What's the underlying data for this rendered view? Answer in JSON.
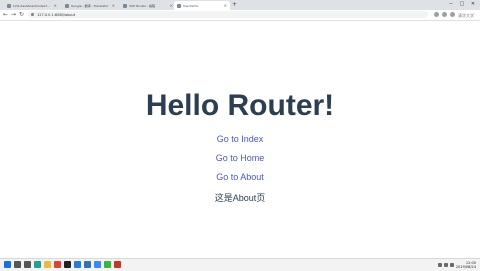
{
  "browser": {
    "tabs": [
      {
        "label": "kimi-dashboard/index?…",
        "active": false
      },
      {
        "label": "Google - 翻译 - Translator",
        "active": false
      },
      {
        "label": "VUE Router - 编程",
        "active": false
      },
      {
        "label": "Vue Demo",
        "active": true
      }
    ],
    "new_tab_symbol": "+",
    "window_controls": {
      "minimize": "−",
      "maximize": "□",
      "close": "✕"
    },
    "nav": {
      "back": "←",
      "forward": "→",
      "reload": "↻"
    },
    "address": "127.0.0.1:8080/about"
  },
  "watermark": "清华大学",
  "page": {
    "title": "Hello Router!",
    "links": [
      {
        "label": "Go to Index"
      },
      {
        "label": "Go to Home"
      },
      {
        "label": "Go to About"
      }
    ],
    "router_view_text": "这是About页"
  },
  "taskbar": {
    "icons": [
      {
        "name": "windows-start-icon",
        "color": "#1e6fd9"
      },
      {
        "name": "search-icon",
        "color": "#555555"
      },
      {
        "name": "task-view-icon",
        "color": "#555555"
      },
      {
        "name": "edge-icon",
        "color": "#2a9d8f"
      },
      {
        "name": "file-explorer-icon",
        "color": "#e9b949"
      },
      {
        "name": "chrome-icon",
        "color": "#db4437"
      },
      {
        "name": "terminal-icon",
        "color": "#222222"
      },
      {
        "name": "vscode-icon",
        "color": "#2b7bd6"
      },
      {
        "name": "store-icon",
        "color": "#3a6fb0"
      },
      {
        "name": "mail-icon",
        "color": "#4285f4"
      },
      {
        "name": "wechat-icon",
        "color": "#3cb34a"
      },
      {
        "name": "music-icon",
        "color": "#c0392b"
      }
    ],
    "clock_time": "12:00",
    "clock_date": "2019/08/24"
  },
  "colors": {
    "title": "#2c3e50",
    "link": "#4c58b6",
    "text": "#2c3e50"
  }
}
